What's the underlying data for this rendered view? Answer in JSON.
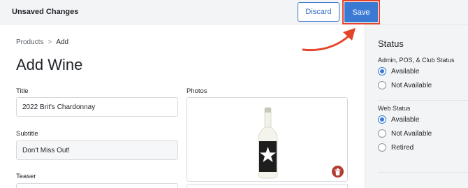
{
  "topbar": {
    "title": "Unsaved Changes",
    "discard_label": "Discard",
    "save_label": "Save"
  },
  "breadcrumb": {
    "root": "Products",
    "separator": ">",
    "current": "Add"
  },
  "page_title": "Add Wine",
  "form": {
    "title_label": "Title",
    "title_value": "2022 Brit's Chardonnay",
    "subtitle_label": "Subtitle",
    "subtitle_value": "Don't Miss Out!",
    "teaser_label": "Teaser",
    "teaser_value": "",
    "photos_label": "Photos"
  },
  "sidebar": {
    "heading": "Status",
    "admin_status": {
      "label": "Admin, POS, & Club Status",
      "options": [
        {
          "label": "Available",
          "selected": true
        },
        {
          "label": "Not Available",
          "selected": false
        }
      ]
    },
    "web_status": {
      "label": "Web Status",
      "options": [
        {
          "label": "Available",
          "selected": true
        },
        {
          "label": "Not Available",
          "selected": false
        },
        {
          "label": "Retired",
          "selected": false
        }
      ]
    }
  },
  "colors": {
    "primary": "#3b7ad2",
    "highlight": "#e4452a",
    "delete": "#b23b32"
  },
  "icons": [
    "arrow-annotation-icon",
    "wine-bottle-image",
    "trash-icon"
  ]
}
